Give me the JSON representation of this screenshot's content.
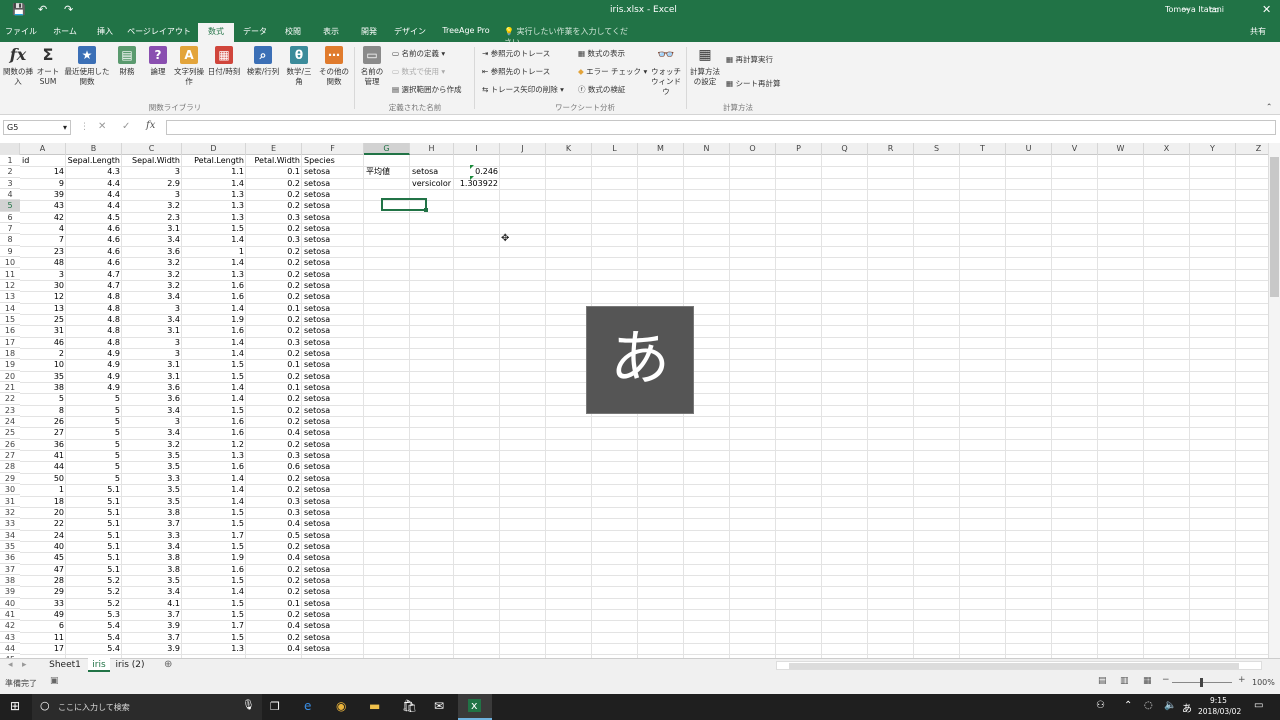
{
  "title": {
    "quick_save": "💾",
    "undo": "↶",
    "redo": "↷",
    "window_title": "iris.xlsx - Excel",
    "user": "Tomoya Itatani",
    "share": "共有",
    "minimize": "─",
    "maximize": "▭",
    "close": "✕"
  },
  "tabs": [
    "ファイル",
    "ホーム",
    "挿入",
    "ページレイアウト",
    "数式",
    "データ",
    "校閲",
    "表示",
    "開発",
    "デザイン",
    "TreeAge Pro"
  ],
  "tell_me": "実行したい作業を入力してください...",
  "ribbon": {
    "big": [
      "関数の挿入",
      "オート SUM",
      "最近使用した関数",
      "財務",
      "論理",
      "文字列操作",
      "日付/時刻",
      "検索/行列",
      "数学/三角",
      "その他の関数",
      "名前の管理"
    ],
    "names": [
      "名前の定義",
      "数式で使用",
      "選択範囲から作成"
    ],
    "audit": [
      "参照元のトレース",
      "参照先のトレース",
      "トレース矢印の削除",
      "数式の表示",
      "エラー チェック",
      "数式の検証"
    ],
    "watch": "ウォッチ ウィンドウ",
    "calc": [
      "計算方法の設定",
      "再計算実行",
      "シート再計算"
    ],
    "groups": [
      "関数ライブラリ",
      "定義された名前",
      "ワークシート分析",
      "計算方法"
    ]
  },
  "formula_bar": {
    "name_box": "G5",
    "cancel": "✕",
    "enter": "✓",
    "fx": "fx",
    "value": ""
  },
  "columns": [
    "A",
    "B",
    "C",
    "D",
    "E",
    "F",
    "G",
    "H",
    "I",
    "J",
    "K",
    "L",
    "M",
    "N",
    "O",
    "P",
    "Q",
    "R",
    "S",
    "T",
    "U",
    "V",
    "W",
    "X",
    "Y",
    "Z"
  ],
  "selected_col": "G",
  "selected_row": 5,
  "headers": [
    "id",
    "Sepal.Length",
    "Sepal.Width",
    "Petal.Length",
    "Petal.Width",
    "Species"
  ],
  "rows": [
    [
      14,
      4.3,
      3,
      1.1,
      0.1,
      "setosa"
    ],
    [
      9,
      4.4,
      2.9,
      1.4,
      0.2,
      "setosa"
    ],
    [
      39,
      4.4,
      3,
      1.3,
      0.2,
      "setosa"
    ],
    [
      43,
      4.4,
      3.2,
      1.3,
      0.2,
      "setosa"
    ],
    [
      42,
      4.5,
      2.3,
      1.3,
      0.3,
      "setosa"
    ],
    [
      4,
      4.6,
      3.1,
      1.5,
      0.2,
      "setosa"
    ],
    [
      7,
      4.6,
      3.4,
      1.4,
      0.3,
      "setosa"
    ],
    [
      23,
      4.6,
      3.6,
      1,
      0.2,
      "setosa"
    ],
    [
      48,
      4.6,
      3.2,
      1.4,
      0.2,
      "setosa"
    ],
    [
      3,
      4.7,
      3.2,
      1.3,
      0.2,
      "setosa"
    ],
    [
      30,
      4.7,
      3.2,
      1.6,
      0.2,
      "setosa"
    ],
    [
      12,
      4.8,
      3.4,
      1.6,
      0.2,
      "setosa"
    ],
    [
      13,
      4.8,
      3,
      1.4,
      0.1,
      "setosa"
    ],
    [
      25,
      4.8,
      3.4,
      1.9,
      0.2,
      "setosa"
    ],
    [
      31,
      4.8,
      3.1,
      1.6,
      0.2,
      "setosa"
    ],
    [
      46,
      4.8,
      3,
      1.4,
      0.3,
      "setosa"
    ],
    [
      2,
      4.9,
      3,
      1.4,
      0.2,
      "setosa"
    ],
    [
      10,
      4.9,
      3.1,
      1.5,
      0.1,
      "setosa"
    ],
    [
      35,
      4.9,
      3.1,
      1.5,
      0.2,
      "setosa"
    ],
    [
      38,
      4.9,
      3.6,
      1.4,
      0.1,
      "setosa"
    ],
    [
      5,
      5,
      3.6,
      1.4,
      0.2,
      "setosa"
    ],
    [
      8,
      5,
      3.4,
      1.5,
      0.2,
      "setosa"
    ],
    [
      26,
      5,
      3,
      1.6,
      0.2,
      "setosa"
    ],
    [
      27,
      5,
      3.4,
      1.6,
      0.4,
      "setosa"
    ],
    [
      36,
      5,
      3.2,
      1.2,
      0.2,
      "setosa"
    ],
    [
      41,
      5,
      3.5,
      1.3,
      0.3,
      "setosa"
    ],
    [
      44,
      5,
      3.5,
      1.6,
      0.6,
      "setosa"
    ],
    [
      50,
      5,
      3.3,
      1.4,
      0.2,
      "setosa"
    ],
    [
      1,
      5.1,
      3.5,
      1.4,
      0.2,
      "setosa"
    ],
    [
      18,
      5.1,
      3.5,
      1.4,
      0.3,
      "setosa"
    ],
    [
      20,
      5.1,
      3.8,
      1.5,
      0.3,
      "setosa"
    ],
    [
      22,
      5.1,
      3.7,
      1.5,
      0.4,
      "setosa"
    ],
    [
      24,
      5.1,
      3.3,
      1.7,
      0.5,
      "setosa"
    ],
    [
      40,
      5.1,
      3.4,
      1.5,
      0.2,
      "setosa"
    ],
    [
      45,
      5.1,
      3.8,
      1.9,
      0.4,
      "setosa"
    ],
    [
      47,
      5.1,
      3.8,
      1.6,
      0.2,
      "setosa"
    ],
    [
      28,
      5.2,
      3.5,
      1.5,
      0.2,
      "setosa"
    ],
    [
      29,
      5.2,
      3.4,
      1.4,
      0.2,
      "setosa"
    ],
    [
      33,
      5.2,
      4.1,
      1.5,
      0.1,
      "setosa"
    ],
    [
      49,
      5.3,
      3.7,
      1.5,
      0.2,
      "setosa"
    ],
    [
      6,
      5.4,
      3.9,
      1.7,
      0.4,
      "setosa"
    ],
    [
      11,
      5.4,
      3.7,
      1.5,
      0.2,
      "setosa"
    ],
    [
      17,
      5.4,
      3.9,
      1.3,
      0.4,
      "setosa"
    ]
  ],
  "extra": {
    "g2": "平均値",
    "h2": "setosa",
    "h3": "versicolor",
    "i2": "0.246",
    "i3": "1.303922"
  },
  "ime_char": "あ",
  "sheets": [
    "Sheet1",
    "iris",
    "iris (2)"
  ],
  "active_sheet": "iris",
  "add_sheet": "⊕",
  "status": {
    "ready": "準備完了",
    "zoom": "100%"
  },
  "taskbar": {
    "search": "ここに入力して検索",
    "time": "9:15",
    "date": "2018/03/02",
    "ime": "あ"
  }
}
